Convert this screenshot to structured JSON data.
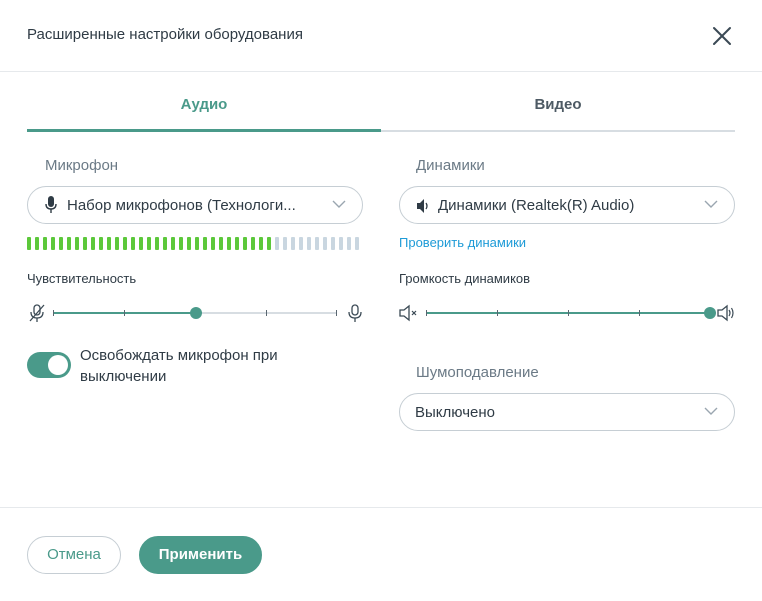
{
  "dialog": {
    "title": "Расширенные настройки оборудования",
    "close_icon": "close-icon"
  },
  "tabs": [
    {
      "label": "Аудио",
      "active": true
    },
    {
      "label": "Видео",
      "active": false
    }
  ],
  "microphone": {
    "label": "Микрофон",
    "selected": "Набор микрофонов (Технологи...",
    "icon": "microphone-icon",
    "level_active_bars": 31,
    "level_total_bars": 42,
    "level_colors": {
      "active": "#5cc83a",
      "inactive": "#c9d6e0"
    }
  },
  "sensitivity": {
    "label": "Чувствительность",
    "value_fraction": 0.5,
    "min_icon": "microphone-muted-icon",
    "max_icon": "microphone-icon"
  },
  "release_mic": {
    "label": "Освобождать микрофон при выключении",
    "enabled": true
  },
  "speakers": {
    "label": "Динамики",
    "selected": "Динамики (Realtek(R) Audio)",
    "icon": "speaker-icon",
    "test_link": "Проверить динамики"
  },
  "speaker_volume": {
    "label": "Громкость динамиков",
    "value_fraction": 1.0,
    "min_icon": "speaker-muted-icon",
    "max_icon": "speaker-loud-icon"
  },
  "noise_suppression": {
    "label": "Шумоподавление",
    "selected": "Выключено"
  },
  "footer": {
    "cancel_label": "Отмена",
    "apply_label": "Применить"
  },
  "colors": {
    "accent": "#4a9a8a",
    "link": "#1e9bd7"
  }
}
